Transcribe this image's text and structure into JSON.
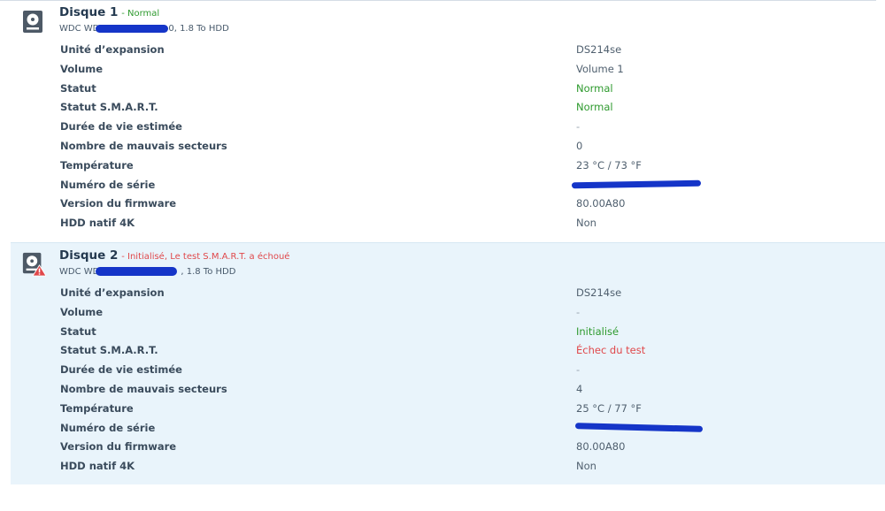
{
  "colors": {
    "ok": "#2e9a2e",
    "error": "#e0484b",
    "selected_bg": "#e9f4fb",
    "redaction": "#1535c8"
  },
  "disks": [
    {
      "name": "Disque 1",
      "status_text": "- Normal",
      "status_color": "ok",
      "model_prefix": "WDC WD",
      "model_suffix": "0, 1.8 To HDD",
      "icon": "hard-disk-icon",
      "fields": [
        {
          "label": "Unité d’expansion",
          "value": "DS214se"
        },
        {
          "label": "Volume",
          "value": "Volume 1"
        },
        {
          "label": "Statut",
          "value": "Normal"
        },
        {
          "label": "Statut S.M.A.R.T.",
          "value": "Normal"
        },
        {
          "label": "Durée de vie estimée",
          "value": "-"
        },
        {
          "label": "Nombre de mauvais secteurs",
          "value": "0"
        },
        {
          "label": "Température",
          "value": "23 °C / 73 °F"
        },
        {
          "label": "Numéro de série",
          "value": ""
        },
        {
          "label": "Version du firmware",
          "value": "80.00A80"
        },
        {
          "label": "HDD natif 4K",
          "value": "Non"
        }
      ]
    },
    {
      "name": "Disque 2",
      "status_text": "- Initialisé, Le test S.M.A.R.T. a échoué",
      "status_color": "error",
      "model_prefix": "WDC WD",
      "model_suffix": ", 1.8 To HDD",
      "icon": "hard-disk-warning-icon",
      "fields": [
        {
          "label": "Unité d’expansion",
          "value": "DS214se"
        },
        {
          "label": "Volume",
          "value": "-"
        },
        {
          "label": "Statut",
          "value": "Initialisé"
        },
        {
          "label": "Statut S.M.A.R.T.",
          "value": "Échec du test"
        },
        {
          "label": "Durée de vie estimée",
          "value": "-"
        },
        {
          "label": "Nombre de mauvais secteurs",
          "value": "4"
        },
        {
          "label": "Température",
          "value": "25 °C / 77 °F"
        },
        {
          "label": "Numéro de série",
          "value": ""
        },
        {
          "label": "Version du firmware",
          "value": "80.00A80"
        },
        {
          "label": "HDD natif 4K",
          "value": "Non"
        }
      ]
    }
  ]
}
